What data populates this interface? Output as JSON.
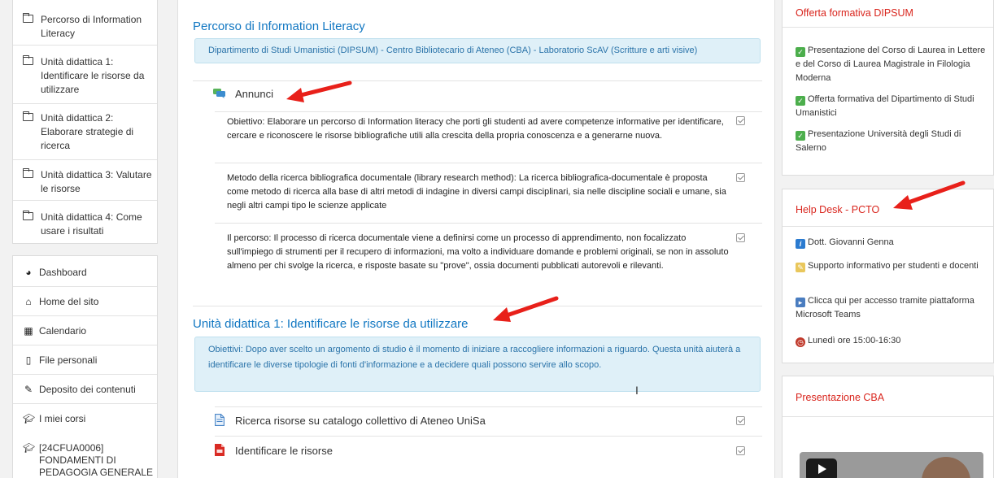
{
  "left_nav": {
    "units": [
      {
        "label": "Percorso di Information Literacy"
      },
      {
        "label": "Unità didattica 1: Identificare le risorse da utilizzare"
      },
      {
        "label": "Unità didattica 2: Elaborare strategie di ricerca"
      },
      {
        "label": "Unità didattica 3: Valutare le risorse"
      },
      {
        "label": "Unità didattica 4: Come usare i risultati"
      }
    ],
    "links": [
      {
        "label": "Dashboard",
        "icon": "dashboard-icon"
      },
      {
        "label": "Home del sito",
        "icon": "home-icon"
      },
      {
        "label": "Calendario",
        "icon": "calendar-icon"
      },
      {
        "label": "File personali",
        "icon": "file-icon"
      },
      {
        "label": "Deposito dei contenuti",
        "icon": "brush-icon"
      },
      {
        "label": "I miei corsi",
        "icon": "graduation-cap-icon"
      }
    ],
    "course": {
      "line1": "[24CFUA0006]",
      "line2": "FONDAMENTI DI",
      "line3": "PEDAGOGIA GENERALE -"
    }
  },
  "main": {
    "section1": {
      "title": "Percorso di Information Literacy",
      "summary": "Dipartimento di Studi Umanistici (DIPSUM) - Centro Bibliotecario di Ateneo (CBA) - Laboratorio ScAV  (Scritture e arti visive)",
      "forum_label": "Annunci",
      "paragraphs": [
        "Obiettivo: Elaborare un percorso di Information literacy che porti gli studenti ad avere competenze informative per identificare, cercare e riconoscere le risorse bibliografiche utili alla crescita della propria conoscenza e a generarne nuova.",
        "Metodo della ricerca bibliografica documentale (library research method): La ricerca bibliografica-documentale è proposta come metodo di ricerca alla base di altri metodi di indagine in diversi campi disciplinari, sia nelle discipline sociali e umane, sia negli altri campi tipo le scienze applicate",
        "Il percorso: Il processo di ricerca documentale viene a definirsi come un processo di apprendimento, non focalizzato sull'impiego di strumenti per il recupero di informazioni, ma volto a individuare domande e problemi originali, se non in assoluto almeno per chi svolge la ricerca, e risposte basate su \"prove\", ossia documenti pubblicati autorevoli e rilevanti."
      ]
    },
    "section2": {
      "title": "Unità didattica 1: Identificare le risorse da utilizzare",
      "summary": "Obiettivi: Dopo aver scelto un argomento di studio è il momento di iniziare a raccogliere informazioni a riguardo. Questa unità aiuterà a identificare le diverse tipologie di fonti d'informazione e a decidere quali possono servire allo scopo.",
      "resources": [
        {
          "label": "Ricerca risorse su catalogo collettivo di Ateneo UniSa",
          "icon": "page-icon"
        },
        {
          "label": "Identificare le risorse",
          "icon": "pdf-icon"
        }
      ]
    }
  },
  "right": {
    "offerta": {
      "title": "Offerta formativa DIPSUM",
      "items": [
        "Presentazione del Corso di Laurea in Lettere e del Corso di Laurea Magistrale in Filologia Moderna",
        "Offerta formativa del Dipartimento di Studi Umanistici",
        "Presentazione Università degli Studi di Salerno"
      ]
    },
    "helpdesk": {
      "title": "Help Desk - PCTO",
      "person": "Dott. Giovanni Genna",
      "support": "Supporto informativo per studenti e docenti",
      "teams": "Clicca qui per accesso tramite piattaforma Microsoft Teams",
      "hours": "Lunedì ore 15:00-16:30"
    },
    "cba": {
      "title": "Presentazione CBA"
    }
  },
  "colors": {
    "link_blue": "#1177c2",
    "block_title_red": "#d9251d",
    "info_bg": "#dff0f8",
    "arrow_red": "#e8201a"
  }
}
